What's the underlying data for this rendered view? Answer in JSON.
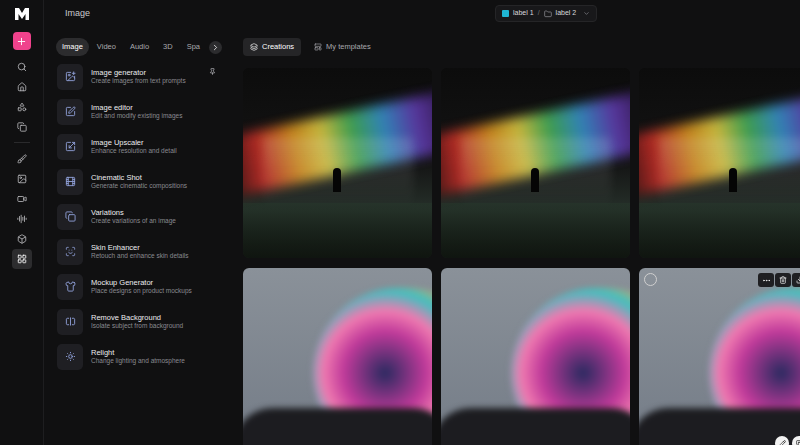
{
  "header": {
    "title": "Image",
    "breadcrumb": [
      {
        "kind": "label",
        "label": "label 1",
        "color": "#1fb6d4"
      },
      {
        "kind": "folder",
        "label": "label 2"
      }
    ]
  },
  "rail": {
    "top": [
      {
        "selected": false
      },
      {
        "selected": false
      },
      {
        "selected": false
      },
      {
        "selected": false
      }
    ],
    "bottom": [
      {
        "selected": false
      },
      {
        "selected": false
      },
      {
        "selected": false
      },
      {
        "selected": false
      },
      {
        "selected": false
      },
      {
        "selected": true
      }
    ]
  },
  "tools": {
    "tabs": [
      {
        "label": "Image",
        "selected": true
      },
      {
        "label": "Video",
        "selected": false
      },
      {
        "label": "Audio",
        "selected": false
      },
      {
        "label": "3D",
        "selected": false
      },
      {
        "label": "Spa",
        "selected": false
      }
    ],
    "items": [
      {
        "title": "Image generator",
        "description": "Create images from text prompts",
        "pinned": true
      },
      {
        "title": "Image editor",
        "description": "Edit and modify existing images",
        "pinned": false
      },
      {
        "title": "Image Upscaler",
        "description": "Enhance resolution and detail",
        "pinned": false
      },
      {
        "title": "Cinematic Shot",
        "description": "Generate cinematic compositions",
        "pinned": false
      },
      {
        "title": "Variations",
        "description": "Create variations of an image",
        "pinned": false
      },
      {
        "title": "Skin Enhancer",
        "description": "Retouch and enhance skin details",
        "pinned": false
      },
      {
        "title": "Mockup Generator",
        "description": "Place designs on product mockups",
        "pinned": false
      },
      {
        "title": "Remove Background",
        "description": "Isolate subject from background",
        "pinned": false
      },
      {
        "title": "Relight",
        "description": "Change lighting and atmosphere",
        "pinned": false
      }
    ]
  },
  "gallery": {
    "tabs": [
      {
        "label": "Creations",
        "selected": true
      },
      {
        "label": "My templates",
        "selected": false
      }
    ],
    "images": [
      {
        "kind": "spectrum",
        "hovered": false
      },
      {
        "kind": "spectrum",
        "hovered": false
      },
      {
        "kind": "spectrum",
        "hovered": false
      },
      {
        "kind": "bubble",
        "hovered": false
      },
      {
        "kind": "bubble",
        "hovered": false
      },
      {
        "kind": "bubble",
        "hovered": true
      }
    ]
  }
}
